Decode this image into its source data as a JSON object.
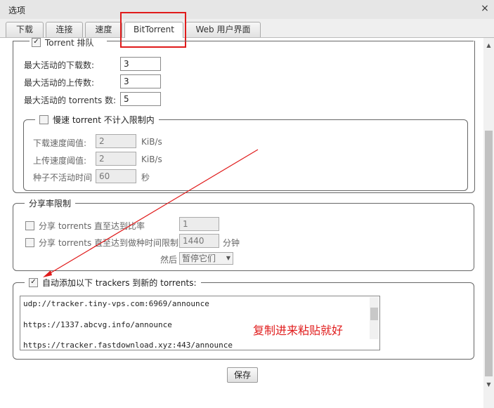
{
  "dialog": {
    "title": "选项",
    "close_symbol": "×"
  },
  "tabs": [
    {
      "label": "下载"
    },
    {
      "label": "连接"
    },
    {
      "label": "速度"
    },
    {
      "label": "BitTorrent"
    },
    {
      "label": "Web 用户界面"
    }
  ],
  "queue": {
    "legend": "Torrent 排队",
    "max_downloads_label": "最大活动的下载数:",
    "max_downloads_value": "3",
    "max_uploads_label": "最大活动的上传数:",
    "max_uploads_value": "3",
    "max_torrents_label": "最大活动的 torrents 数:",
    "max_torrents_value": "5"
  },
  "slow": {
    "legend": "慢速 torrent 不计入限制内",
    "dl_threshold_label": "下载速度阈值:",
    "dl_threshold_value": "2",
    "dl_unit": "KiB/s",
    "ul_threshold_label": "上传速度阈值:",
    "ul_threshold_value": "2",
    "ul_unit": "KiB/s",
    "inactive_label": "种子不活动时间",
    "inactive_value": "60",
    "inactive_unit": "秒"
  },
  "ratio": {
    "legend": "分享率限制",
    "ratio_label": "分享 torrents 直至达到比率",
    "ratio_value": "1",
    "time_label": "分享 torrents 直至达到做种时间限制",
    "time_value": "1440",
    "time_unit": "分钟",
    "then_label": "然后",
    "action_value": "暂停它们"
  },
  "trackers": {
    "legend": "自动添加以下 trackers 到新的 torrents:",
    "lines": [
      "udp://tracker.tiny-vps.com:6969/announce",
      "https://1337.abcvg.info/announce",
      "https://tracker.fastdownload.xyz:443/announce"
    ]
  },
  "annotation": "复制进来粘贴就好",
  "save_label": "保存",
  "colors": {
    "annotation_red": "#e01b1b"
  }
}
